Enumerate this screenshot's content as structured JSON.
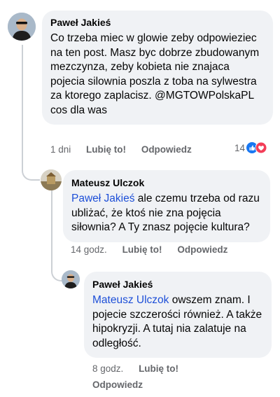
{
  "comments": [
    {
      "author": "Paweł Jakieś",
      "text": "Co trzeba miec w glowie zeby odpowieziec na ten post. Masz byc dobrze zbudowanym mezczynza, zeby kobieta nie znajaca pojecia silownia poszla z toba na sylwestra za ktorego zaplacisz. @MGTOWPolskaPL cos dla was",
      "time": "1 dni",
      "like": "Lubię to!",
      "reply": "Odpowiedz",
      "reaction_count": "14",
      "reactions": [
        "like-reaction-icon",
        "love-reaction-icon"
      ]
    },
    {
      "author": "Mateusz Ulczok",
      "mention": "Paweł Jakieś",
      "text": " ale czemu trzeba od razu ubliżać, że ktoś nie zna pojęcia siłownia? A Ty znasz pojęcie kultura?",
      "time": "14 godz.",
      "like": "Lubię to!",
      "reply": "Odpowiedz"
    },
    {
      "author": "Paweł Jakieś",
      "mention": "Mateusz Ulczok",
      "text": " owszem znam. I pojecie szczerości również. A także hipokryzji. A tutaj nia zalatuje na odległość.",
      "time": "8 godz.",
      "like": "Lubię to!",
      "reply": "Odpowiedz"
    }
  ],
  "colors": {
    "bubble": "#f0f2f5",
    "mention": "#1d4fd8",
    "meta": "#65676b",
    "like_blue": "#1877f2",
    "love_red": "#f33e58"
  }
}
